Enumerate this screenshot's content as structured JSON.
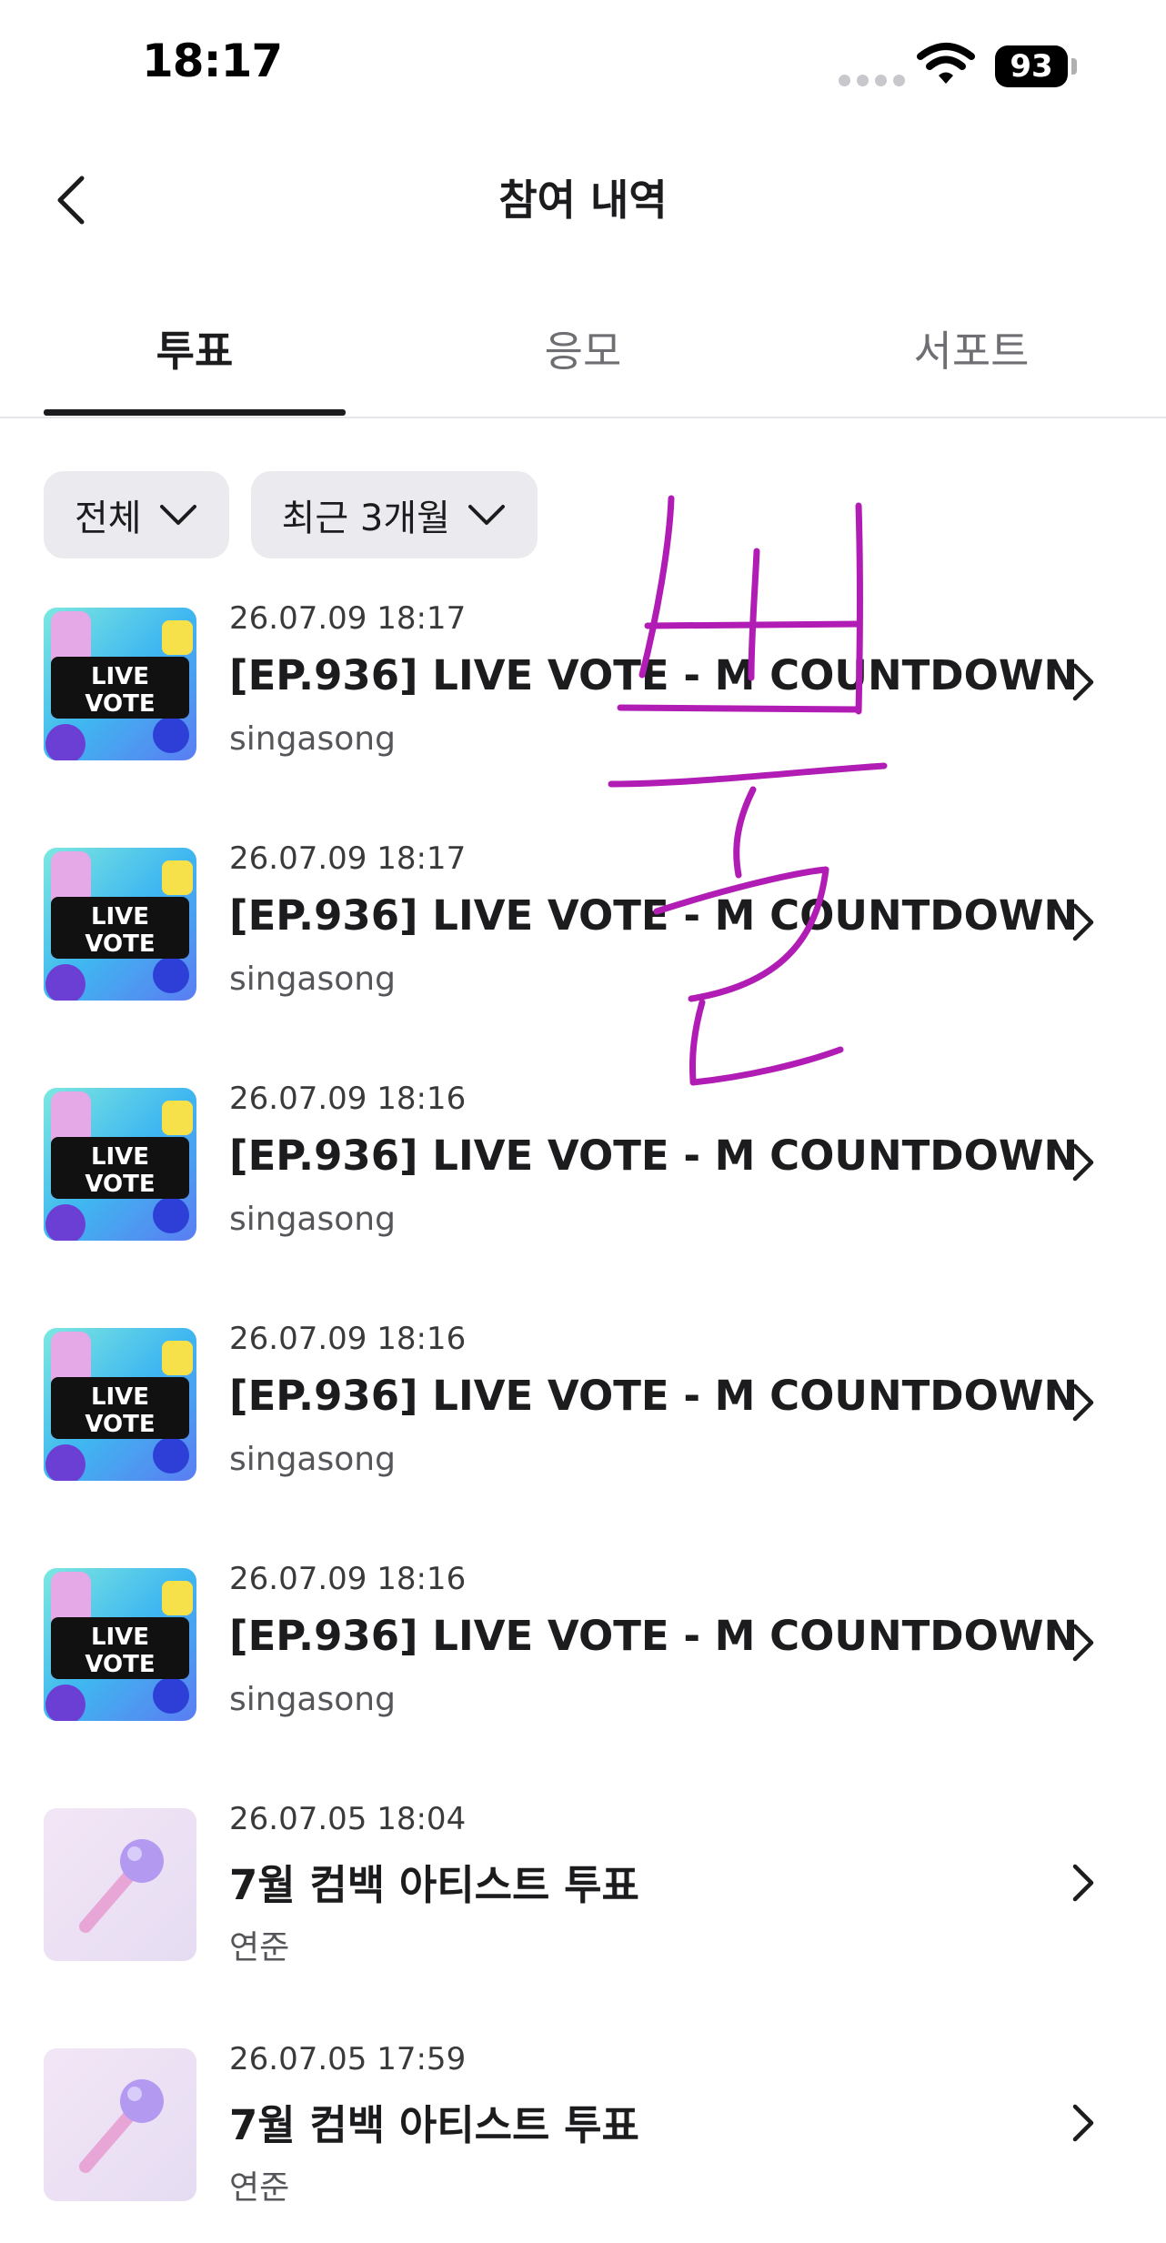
{
  "status_bar": {
    "time": "18:17",
    "battery": "93"
  },
  "header": {
    "title": "참여 내역"
  },
  "tabs": [
    {
      "label": "투표",
      "active": true
    },
    {
      "label": "응모",
      "active": false
    },
    {
      "label": "서포트",
      "active": false
    }
  ],
  "filters": [
    {
      "label": "전체"
    },
    {
      "label": "최근 3개월"
    }
  ],
  "items": [
    {
      "date": "26.07.09 18:17",
      "title": "[EP.936] LIVE VOTE - M COUNTDOWN",
      "subtitle": "singasong",
      "thumb": "live-vote",
      "thumb_text_1": "LIVE",
      "thumb_text_2": "VOTE"
    },
    {
      "date": "26.07.09 18:17",
      "title": "[EP.936] LIVE VOTE - M COUNTDOWN",
      "subtitle": "singasong",
      "thumb": "live-vote",
      "thumb_text_1": "LIVE",
      "thumb_text_2": "VOTE"
    },
    {
      "date": "26.07.09 18:16",
      "title": "[EP.936] LIVE VOTE - M COUNTDOWN",
      "subtitle": "singasong",
      "thumb": "live-vote",
      "thumb_text_1": "LIVE",
      "thumb_text_2": "VOTE"
    },
    {
      "date": "26.07.09 18:16",
      "title": "[EP.936] LIVE VOTE - M COUNTDOWN",
      "subtitle": "singasong",
      "thumb": "live-vote",
      "thumb_text_1": "LIVE",
      "thumb_text_2": "VOTE"
    },
    {
      "date": "26.07.09 18:16",
      "title": "[EP.936] LIVE VOTE - M COUNTDOWN",
      "subtitle": "singasong",
      "thumb": "live-vote",
      "thumb_text_1": "LIVE",
      "thumb_text_2": "VOTE"
    },
    {
      "date": "26.07.05 18:04",
      "title": "7월 컴백 아티스트 투표",
      "subtitle": "연준",
      "thumb": "microphone"
    },
    {
      "date": "26.07.05 17:59",
      "title": "7월 컴백 아티스트 투표",
      "subtitle": "연준",
      "thumb": "microphone"
    }
  ],
  "overlay": {
    "handwritten_text": "뿔",
    "color": "#b01cb4"
  },
  "colors": {
    "text": "#1c1c1e",
    "chip_bg": "#ebebef",
    "divider": "#e5e5ea"
  }
}
